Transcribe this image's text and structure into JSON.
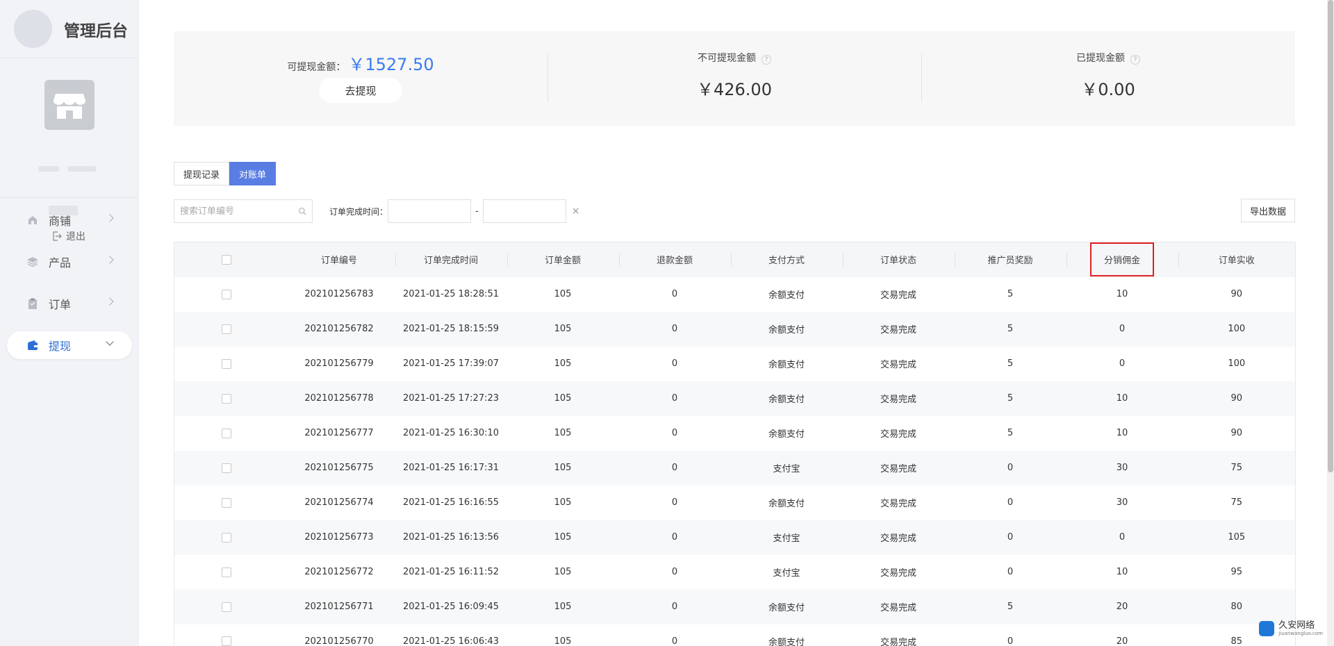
{
  "brand": {
    "title": "管理后台"
  },
  "profile": {
    "logout_label": "退出"
  },
  "nav": {
    "items": [
      {
        "label": "商铺",
        "icon": "shop-icon"
      },
      {
        "label": "产品",
        "icon": "layers-icon"
      },
      {
        "label": "订单",
        "icon": "clipboard-icon"
      },
      {
        "label": "提现",
        "icon": "wallet-icon",
        "active": true
      }
    ]
  },
  "summary": {
    "available_label": "可提现金额：",
    "available_amount": "￥1527.50",
    "withdraw_button": "去提现",
    "unavailable_label": "不可提现金额",
    "unavailable_amount": "￥426.00",
    "withdrawn_label": "已提现金额",
    "withdrawn_amount": "￥0.00",
    "help_glyph": "?"
  },
  "tabs": [
    {
      "label": "提现记录",
      "active": false
    },
    {
      "label": "对账单",
      "active": true
    }
  ],
  "filters": {
    "search_placeholder": "搜索订单编号",
    "date_label": "订单完成时间：",
    "date_separator": "-",
    "clear_glyph": "×",
    "export_label": "导出数据"
  },
  "table": {
    "headers": [
      "订单编号",
      "订单完成时间",
      "订单金额",
      "退款金额",
      "支付方式",
      "订单状态",
      "推广员奖励",
      "分销佣金",
      "订单实收"
    ],
    "highlighted_header_index": 7,
    "rows": [
      [
        "202101256783",
        "2021-01-25 18:28:51",
        "105",
        "0",
        "余额支付",
        "交易完成",
        "5",
        "10",
        "90"
      ],
      [
        "202101256782",
        "2021-01-25 18:15:59",
        "105",
        "0",
        "余额支付",
        "交易完成",
        "5",
        "0",
        "100"
      ],
      [
        "202101256779",
        "2021-01-25 17:39:07",
        "105",
        "0",
        "余额支付",
        "交易完成",
        "5",
        "0",
        "100"
      ],
      [
        "202101256778",
        "2021-01-25 17:27:23",
        "105",
        "0",
        "余额支付",
        "交易完成",
        "5",
        "10",
        "90"
      ],
      [
        "202101256777",
        "2021-01-25 16:30:10",
        "105",
        "0",
        "余额支付",
        "交易完成",
        "5",
        "10",
        "90"
      ],
      [
        "202101256775",
        "2021-01-25 16:17:31",
        "105",
        "0",
        "支付宝",
        "交易完成",
        "0",
        "30",
        "75"
      ],
      [
        "202101256774",
        "2021-01-25 16:16:55",
        "105",
        "0",
        "余额支付",
        "交易完成",
        "0",
        "30",
        "75"
      ],
      [
        "202101256773",
        "2021-01-25 16:13:56",
        "105",
        "0",
        "支付宝",
        "交易完成",
        "0",
        "0",
        "105"
      ],
      [
        "202101256772",
        "2021-01-25 16:11:52",
        "105",
        "0",
        "支付宝",
        "交易完成",
        "0",
        "10",
        "95"
      ],
      [
        "202101256771",
        "2021-01-25 16:09:45",
        "105",
        "0",
        "余额支付",
        "交易完成",
        "5",
        "20",
        "80"
      ],
      [
        "202101256770",
        "2021-01-25 16:06:43",
        "105",
        "0",
        "余额支付",
        "交易完成",
        "0",
        "20",
        "85"
      ]
    ]
  },
  "watermark": {
    "title": "久安网络",
    "subtitle": "Jiuanwangluo.com"
  },
  "colors": {
    "accent": "#3a7bf0",
    "tab_active": "#5a7de3",
    "highlight_box": "#e02020",
    "sidebar_bg": "#f2f3f7"
  }
}
